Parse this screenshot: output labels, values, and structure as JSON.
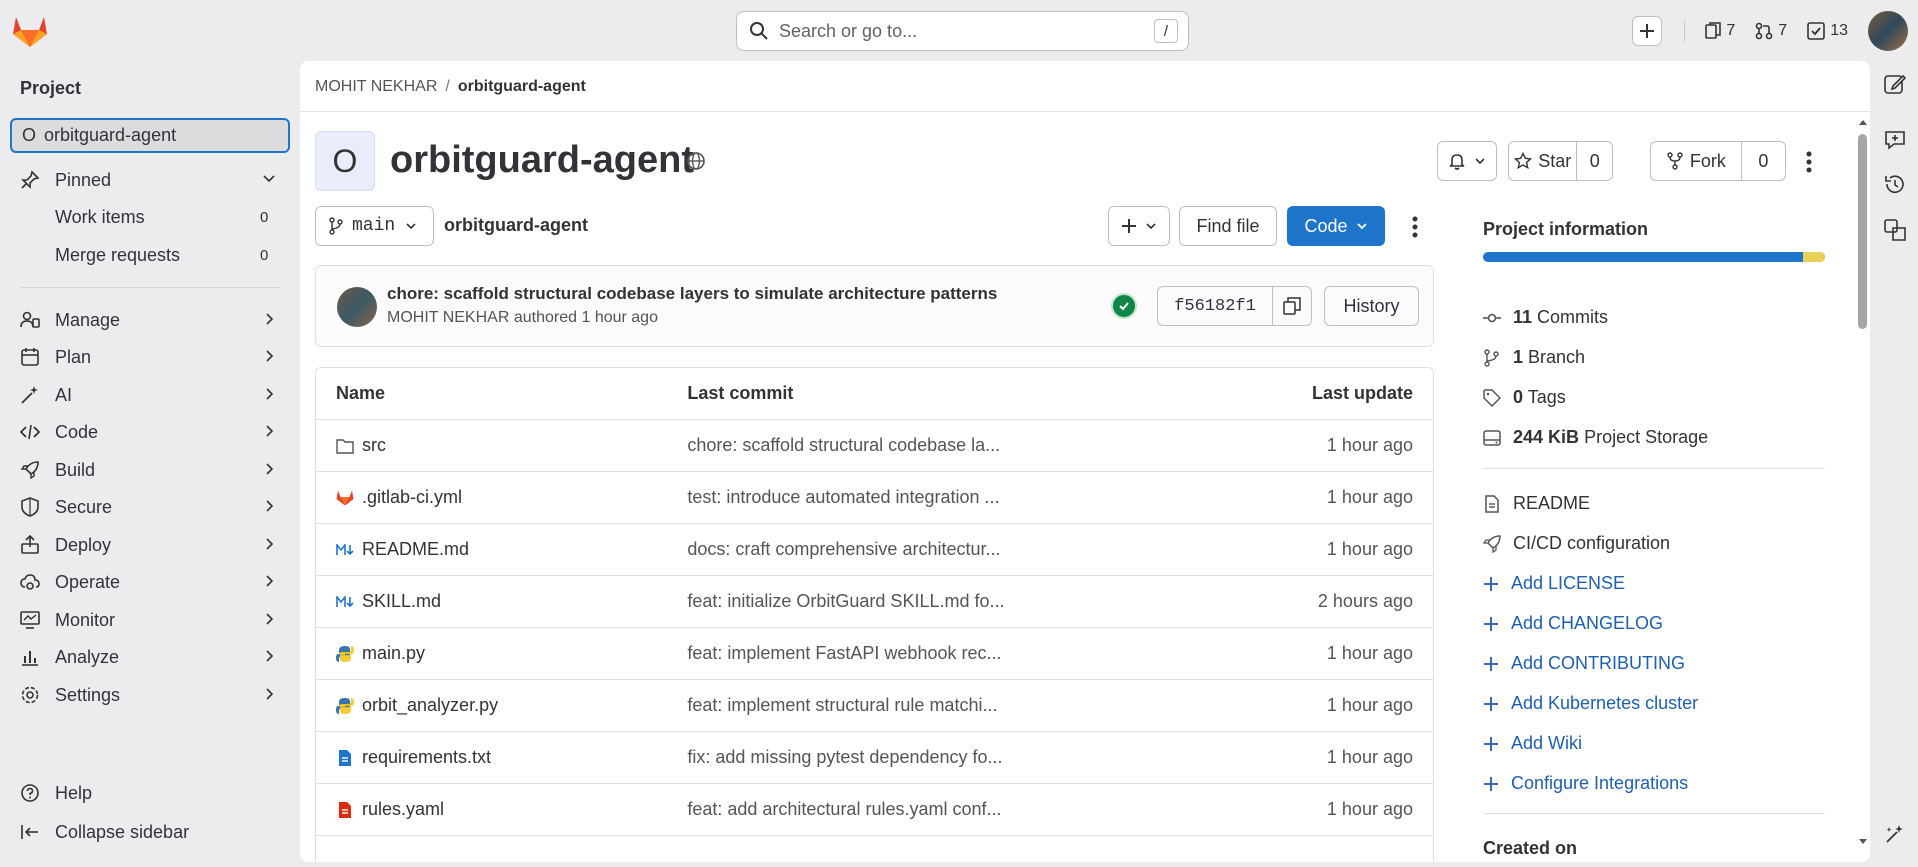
{
  "search": {
    "placeholder": "Search or go to...",
    "shortcut": "/"
  },
  "top_counts": {
    "issues": "7",
    "merge_requests": "7",
    "todos": "13"
  },
  "sidebar": {
    "heading": "Project",
    "project_letter": "O",
    "project_name": "orbitguard-agent",
    "pinned": "Pinned",
    "work_items": "Work items",
    "work_items_count": "0",
    "merge_requests": "Merge requests",
    "merge_requests_count": "0",
    "items": [
      "Manage",
      "Plan",
      "AI",
      "Code",
      "Build",
      "Secure",
      "Deploy",
      "Operate",
      "Monitor",
      "Analyze",
      "Settings"
    ],
    "help": "Help",
    "collapse": "Collapse sidebar"
  },
  "breadcrumb": {
    "owner": "MOHIT NEKHAR",
    "sep": "/",
    "project": "orbitguard-agent"
  },
  "project": {
    "letter": "O",
    "title": "orbitguard-agent"
  },
  "actions": {
    "star": "Star",
    "star_count": "0",
    "fork": "Fork",
    "fork_count": "0"
  },
  "repo": {
    "branch": "main",
    "path": "orbitguard-agent",
    "find_file": "Find file",
    "code": "Code"
  },
  "last_commit": {
    "message": "chore: scaffold structural codebase layers to simulate architecture patterns",
    "author": "MOHIT NEKHAR",
    "authored": "authored",
    "time": "1 hour ago",
    "sha": "f56182f1",
    "history": "History"
  },
  "files": {
    "headers": [
      "Name",
      "Last commit",
      "Last update"
    ],
    "rows": [
      {
        "name": "src",
        "icon": "folder-icon",
        "commit": "chore: scaffold structural codebase la...",
        "updated": "1 hour ago"
      },
      {
        "name": ".gitlab-ci.yml",
        "icon": "gitlab-icon",
        "commit": "test: introduce automated integration ...",
        "updated": "1 hour ago"
      },
      {
        "name": "README.md",
        "icon": "markdown-icon",
        "commit": "docs: craft comprehensive architectur...",
        "updated": "1 hour ago"
      },
      {
        "name": "SKILL.md",
        "icon": "markdown-icon",
        "commit": "feat: initialize OrbitGuard SKILL.md fo...",
        "updated": "2 hours ago"
      },
      {
        "name": "main.py",
        "icon": "python-icon",
        "commit": "feat: implement FastAPI webhook rec...",
        "updated": "1 hour ago"
      },
      {
        "name": "orbit_analyzer.py",
        "icon": "python-icon",
        "commit": "feat: implement structural rule matchi...",
        "updated": "1 hour ago"
      },
      {
        "name": "requirements.txt",
        "icon": "text-file-icon",
        "commit": "fix: add missing pytest dependency fo...",
        "updated": "1 hour ago"
      },
      {
        "name": "rules.yaml",
        "icon": "yaml-icon",
        "commit": "feat: add architectural rules.yaml conf...",
        "updated": "1 hour ago"
      }
    ]
  },
  "project_info": {
    "heading": "Project information",
    "commits_count": "11",
    "commits_label": "Commits",
    "branch_count": "1",
    "branch_label": "Branch",
    "tags_count": "0",
    "tags_label": "Tags",
    "storage": "244 KiB",
    "storage_label": "Project Storage",
    "readme": "README",
    "cicd": "CI/CD configuration",
    "add_links": [
      "Add LICENSE",
      "Add CHANGELOG",
      "Add CONTRIBUTING",
      "Add Kubernetes cluster",
      "Add Wiki",
      "Configure Integrations"
    ],
    "created_on": "Created on"
  }
}
